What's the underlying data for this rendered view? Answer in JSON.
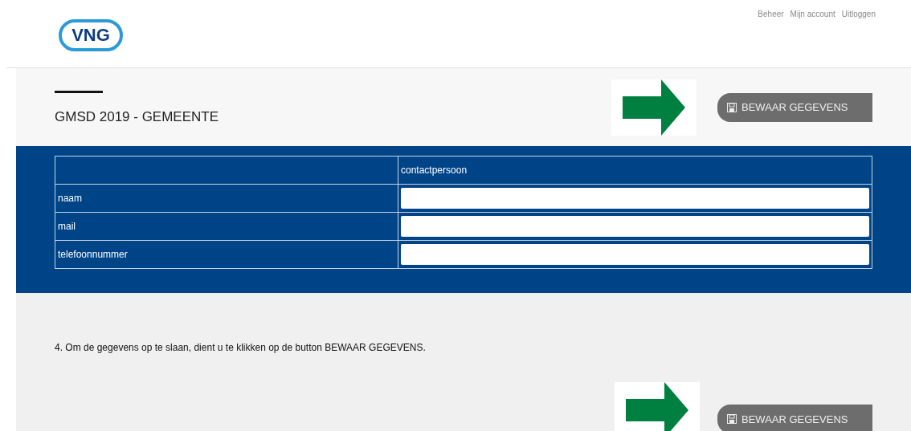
{
  "nav_links": [
    "Beheer",
    "Mijn account",
    "Uitloggen"
  ],
  "logo": "VNG",
  "page_title": "GMSD 2019 - GEMEENTE",
  "save_button": "BEWAAR GEGEVENS",
  "table": {
    "columns": [
      "contactpersoon"
    ],
    "rows": [
      {
        "label": "naam"
      },
      {
        "label": "mail"
      },
      {
        "label": "telefoonnummer"
      }
    ]
  },
  "instruction": "4. Om de gegevens op te slaan, dient u te klikken op de button BEWAAR GEGEVENS.",
  "bottom_button": "BEWAAR GEGEVENS"
}
